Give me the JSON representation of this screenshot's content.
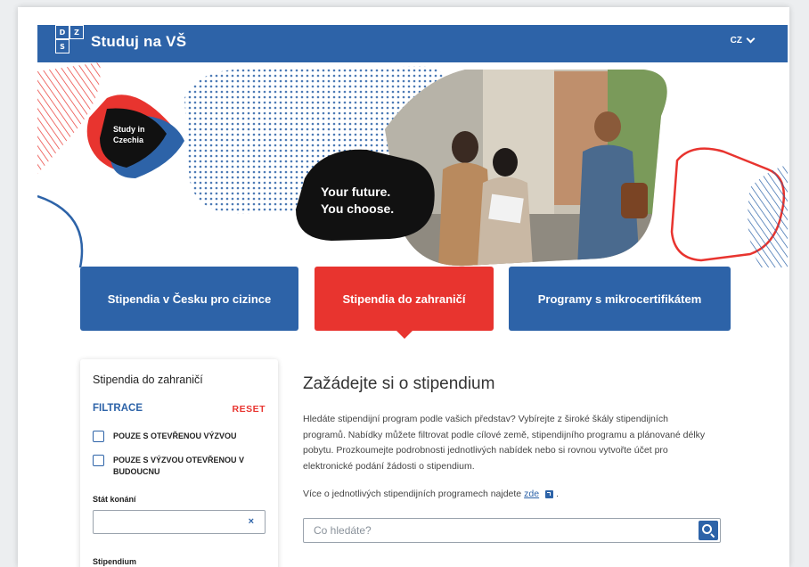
{
  "header": {
    "logo_letters": [
      "D",
      "Z",
      "S"
    ],
    "site_title": "Studuj na VŠ",
    "language": "CZ"
  },
  "hero": {
    "badge_line1": "Study in",
    "badge_line2": "Czechia",
    "slogan_line1": "Your future.",
    "slogan_line2": "You choose."
  },
  "tabs": [
    {
      "label": "Stipendia v Česku pro cizince",
      "active": false
    },
    {
      "label": "Stipendia do zahraničí",
      "active": true
    },
    {
      "label": "Programy s mikrocertifikátem",
      "active": false
    }
  ],
  "filters": {
    "title": "Stipendia do zahraničí",
    "heading": "FILTRACE",
    "reset": "RESET",
    "checkbox_open": "POUZE S OTEVŘENOU VÝZVOU",
    "checkbox_future": "POUZE S VÝZVOU OTEVŘENOU V BUDOUCNU",
    "country_label": "Stát konání",
    "clear_symbol": "×",
    "next_label": "Stipendium"
  },
  "main": {
    "title": "Zažádejte si o stipendium",
    "description": "Hledáte stipendijní program podle vašich představ? Vybírejte z široké škály stipendijních programů. Nabídky můžete filtrovat podle cílové země, stipendijního programu a plánované délky pobytu. Prozkoumejte podrobnosti jednotlivých nabídek nebo si rovnou vytvořte účet pro elektronické podání žádosti o stipendium.",
    "more_text": "Více o jednotlivých stipendijních programech najdete",
    "more_link": "zde",
    "more_suffix": ".",
    "search_placeholder": "Co hledáte?"
  },
  "colors": {
    "brand_blue": "#2d63a8",
    "accent_red": "#e8342f",
    "black": "#111111"
  }
}
